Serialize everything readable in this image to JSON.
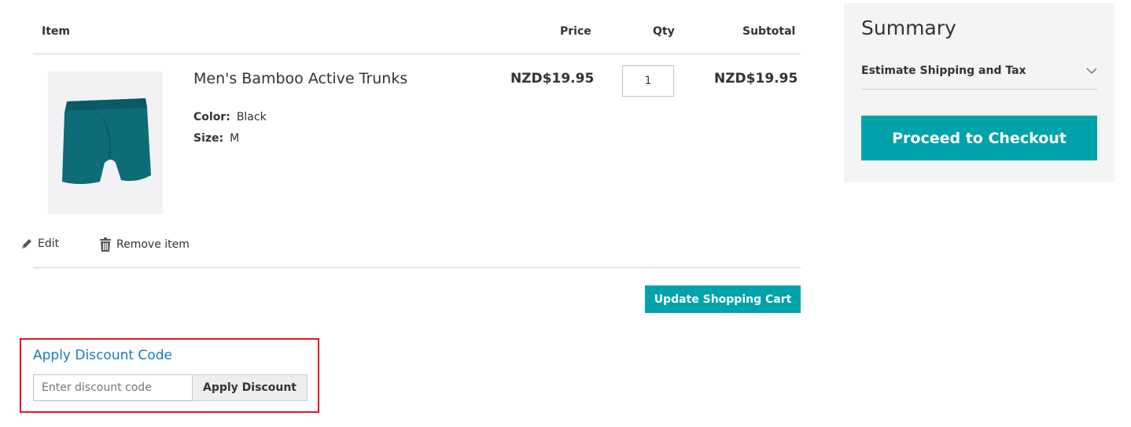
{
  "cart": {
    "headers": {
      "item": "Item",
      "price": "Price",
      "qty": "Qty",
      "subtotal": "Subtotal"
    },
    "items": [
      {
        "name": "Men's Bamboo Active Trunks",
        "options": [
          {
            "label": "Color:",
            "value": "Black"
          },
          {
            "label": "Size:",
            "value": "M"
          }
        ],
        "price": "NZD$19.95",
        "qty": "1",
        "subtotal": "NZD$19.95",
        "image_color": "#0e6b78",
        "actions": {
          "edit": "Edit",
          "remove": "Remove item"
        }
      }
    ],
    "update_button": "Update Shopping Cart"
  },
  "discount": {
    "title": "Apply Discount Code",
    "placeholder": "Enter discount code",
    "button": "Apply Discount",
    "highlight_color": "#e0191f"
  },
  "summary": {
    "title": "Summary",
    "shipping_label": "Estimate Shipping and Tax",
    "checkout_button": "Proceed to Checkout"
  },
  "colors": {
    "accent": "#00a3aa",
    "link": "#1979c3"
  }
}
